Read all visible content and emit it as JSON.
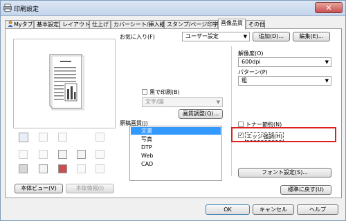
{
  "window": {
    "title": "印刷設定",
    "close_symbol": "✕"
  },
  "tabs": [
    "Myタブ",
    "基本設定",
    "レイアウト",
    "仕上げ",
    "カバーシート/挿入紙",
    "スタンプ/ページ印字",
    "画像品質",
    "その他"
  ],
  "favorites": {
    "label": "お気に入り(F)",
    "value": "ユーザー設定",
    "add_label": "追加(D)...",
    "edit_label": "編集(E)..."
  },
  "left": {
    "view_button": "本体ビュー(V)",
    "info_button": "本体情報(I)"
  },
  "mono_print": {
    "label": "黒で印刷(B)",
    "checked": false,
    "select_value": "文字/図",
    "adjust_button": "画質調整(Q)..."
  },
  "original_quality": {
    "label": "原稿画質(J)",
    "items": [
      "文書",
      "写真",
      "DTP",
      "Web",
      "CAD"
    ],
    "selected_index": 0
  },
  "resolution": {
    "label": "解像度(O)",
    "value": "600dpi"
  },
  "pattern": {
    "label": "パターン(P)",
    "value": "粗"
  },
  "toner_save": {
    "label": "トナー節約(N)",
    "checked": false
  },
  "edge_emphasis": {
    "label": "エッジ強調(H)",
    "checked": true
  },
  "font_settings_button": "フォント設定(S)...",
  "reset_button": "標準に戻す(U)",
  "footer": {
    "ok": "OK",
    "cancel": "キャンセル",
    "help": "ヘルプ"
  },
  "colors": {
    "selection": "#3399ff",
    "highlight_box": "#e02020"
  }
}
